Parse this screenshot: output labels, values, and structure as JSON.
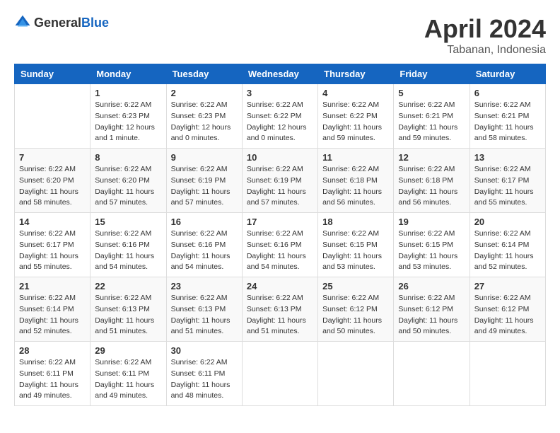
{
  "header": {
    "logo_general": "General",
    "logo_blue": "Blue",
    "month_year": "April 2024",
    "location": "Tabanan, Indonesia"
  },
  "calendar": {
    "weekdays": [
      "Sunday",
      "Monday",
      "Tuesday",
      "Wednesday",
      "Thursday",
      "Friday",
      "Saturday"
    ],
    "weeks": [
      [
        {
          "day": "",
          "info": ""
        },
        {
          "day": "1",
          "info": "Sunrise: 6:22 AM\nSunset: 6:23 PM\nDaylight: 12 hours\nand 1 minute."
        },
        {
          "day": "2",
          "info": "Sunrise: 6:22 AM\nSunset: 6:23 PM\nDaylight: 12 hours\nand 0 minutes."
        },
        {
          "day": "3",
          "info": "Sunrise: 6:22 AM\nSunset: 6:22 PM\nDaylight: 12 hours\nand 0 minutes."
        },
        {
          "day": "4",
          "info": "Sunrise: 6:22 AM\nSunset: 6:22 PM\nDaylight: 11 hours\nand 59 minutes."
        },
        {
          "day": "5",
          "info": "Sunrise: 6:22 AM\nSunset: 6:21 PM\nDaylight: 11 hours\nand 59 minutes."
        },
        {
          "day": "6",
          "info": "Sunrise: 6:22 AM\nSunset: 6:21 PM\nDaylight: 11 hours\nand 58 minutes."
        }
      ],
      [
        {
          "day": "7",
          "info": "Sunrise: 6:22 AM\nSunset: 6:20 PM\nDaylight: 11 hours\nand 58 minutes."
        },
        {
          "day": "8",
          "info": "Sunrise: 6:22 AM\nSunset: 6:20 PM\nDaylight: 11 hours\nand 57 minutes."
        },
        {
          "day": "9",
          "info": "Sunrise: 6:22 AM\nSunset: 6:19 PM\nDaylight: 11 hours\nand 57 minutes."
        },
        {
          "day": "10",
          "info": "Sunrise: 6:22 AM\nSunset: 6:19 PM\nDaylight: 11 hours\nand 57 minutes."
        },
        {
          "day": "11",
          "info": "Sunrise: 6:22 AM\nSunset: 6:18 PM\nDaylight: 11 hours\nand 56 minutes."
        },
        {
          "day": "12",
          "info": "Sunrise: 6:22 AM\nSunset: 6:18 PM\nDaylight: 11 hours\nand 56 minutes."
        },
        {
          "day": "13",
          "info": "Sunrise: 6:22 AM\nSunset: 6:17 PM\nDaylight: 11 hours\nand 55 minutes."
        }
      ],
      [
        {
          "day": "14",
          "info": "Sunrise: 6:22 AM\nSunset: 6:17 PM\nDaylight: 11 hours\nand 55 minutes."
        },
        {
          "day": "15",
          "info": "Sunrise: 6:22 AM\nSunset: 6:16 PM\nDaylight: 11 hours\nand 54 minutes."
        },
        {
          "day": "16",
          "info": "Sunrise: 6:22 AM\nSunset: 6:16 PM\nDaylight: 11 hours\nand 54 minutes."
        },
        {
          "day": "17",
          "info": "Sunrise: 6:22 AM\nSunset: 6:16 PM\nDaylight: 11 hours\nand 54 minutes."
        },
        {
          "day": "18",
          "info": "Sunrise: 6:22 AM\nSunset: 6:15 PM\nDaylight: 11 hours\nand 53 minutes."
        },
        {
          "day": "19",
          "info": "Sunrise: 6:22 AM\nSunset: 6:15 PM\nDaylight: 11 hours\nand 53 minutes."
        },
        {
          "day": "20",
          "info": "Sunrise: 6:22 AM\nSunset: 6:14 PM\nDaylight: 11 hours\nand 52 minutes."
        }
      ],
      [
        {
          "day": "21",
          "info": "Sunrise: 6:22 AM\nSunset: 6:14 PM\nDaylight: 11 hours\nand 52 minutes."
        },
        {
          "day": "22",
          "info": "Sunrise: 6:22 AM\nSunset: 6:13 PM\nDaylight: 11 hours\nand 51 minutes."
        },
        {
          "day": "23",
          "info": "Sunrise: 6:22 AM\nSunset: 6:13 PM\nDaylight: 11 hours\nand 51 minutes."
        },
        {
          "day": "24",
          "info": "Sunrise: 6:22 AM\nSunset: 6:13 PM\nDaylight: 11 hours\nand 51 minutes."
        },
        {
          "day": "25",
          "info": "Sunrise: 6:22 AM\nSunset: 6:12 PM\nDaylight: 11 hours\nand 50 minutes."
        },
        {
          "day": "26",
          "info": "Sunrise: 6:22 AM\nSunset: 6:12 PM\nDaylight: 11 hours\nand 50 minutes."
        },
        {
          "day": "27",
          "info": "Sunrise: 6:22 AM\nSunset: 6:12 PM\nDaylight: 11 hours\nand 49 minutes."
        }
      ],
      [
        {
          "day": "28",
          "info": "Sunrise: 6:22 AM\nSunset: 6:11 PM\nDaylight: 11 hours\nand 49 minutes."
        },
        {
          "day": "29",
          "info": "Sunrise: 6:22 AM\nSunset: 6:11 PM\nDaylight: 11 hours\nand 49 minutes."
        },
        {
          "day": "30",
          "info": "Sunrise: 6:22 AM\nSunset: 6:11 PM\nDaylight: 11 hours\nand 48 minutes."
        },
        {
          "day": "",
          "info": ""
        },
        {
          "day": "",
          "info": ""
        },
        {
          "day": "",
          "info": ""
        },
        {
          "day": "",
          "info": ""
        }
      ]
    ]
  }
}
